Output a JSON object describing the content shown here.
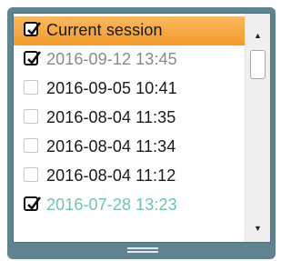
{
  "session_list": {
    "items": [
      {
        "label": "Current session",
        "checked": true,
        "selected": true,
        "color": "#1a1a1a"
      },
      {
        "label": "2016-09-12 13:45",
        "checked": true,
        "selected": false,
        "color": "#8a8a8a"
      },
      {
        "label": "2016-09-05 10:41",
        "checked": false,
        "selected": false,
        "color": "#1a1a1a"
      },
      {
        "label": "2016-08-04 11:35",
        "checked": false,
        "selected": false,
        "color": "#1a1a1a"
      },
      {
        "label": "2016-08-04 11:34",
        "checked": false,
        "selected": false,
        "color": "#1a1a1a"
      },
      {
        "label": "2016-08-04 11:12",
        "checked": false,
        "selected": false,
        "color": "#1a1a1a"
      },
      {
        "label": "2016-07-28 13:23",
        "checked": true,
        "selected": false,
        "color": "#6fc8a4"
      }
    ]
  },
  "scrollbar": {
    "up_icon": "triangle-up",
    "down_icon": "triangle-down"
  },
  "colors": {
    "frame": "#5f8391",
    "selection": "#f6a53c"
  }
}
